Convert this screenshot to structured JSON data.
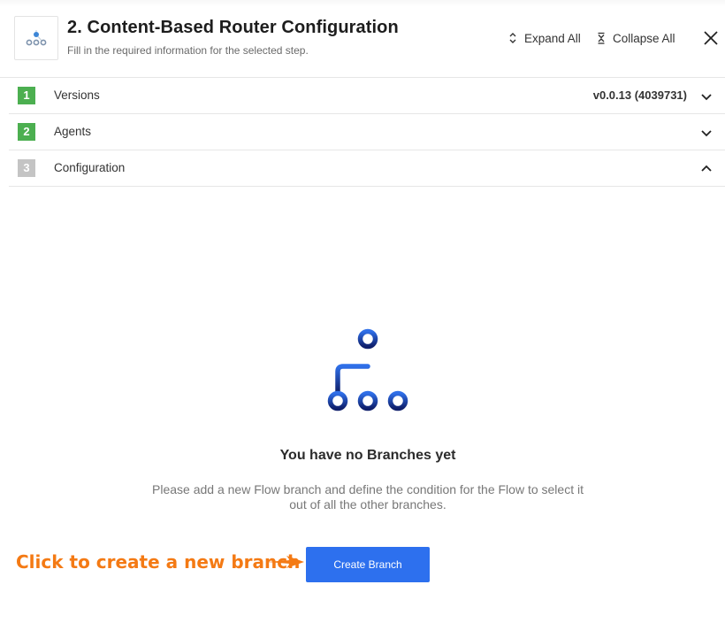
{
  "header": {
    "title": "2. Content-Based Router Configuration",
    "subtitle": "Fill in the required information for the selected step.",
    "step_icon": "content-router-icon",
    "expand_all_label": "Expand All",
    "collapse_all_label": "Collapse All",
    "close_icon": "close-icon"
  },
  "steps": [
    {
      "number": "1",
      "label": "Versions",
      "value": "v0.0.13 (4039731)",
      "status": "completed",
      "expanded": false
    },
    {
      "number": "2",
      "label": "Agents",
      "value": "",
      "status": "completed",
      "expanded": false
    },
    {
      "number": "3",
      "label": "Configuration",
      "value": "",
      "status": "pending",
      "expanded": true
    }
  ],
  "empty_state": {
    "icon": "branches-icon",
    "title": "You have no Branches yet",
    "description": "Please add a new Flow branch and define the condition for the Flow to select it out of all the other branches."
  },
  "annotation": {
    "text": "Click to create a new branch",
    "color": "#f47a14"
  },
  "actions": {
    "create_branch_label": "Create Branch"
  },
  "colors": {
    "primary": "#2d70ee",
    "step_done": "#4caf50",
    "step_pending": "#c4c4c4"
  }
}
